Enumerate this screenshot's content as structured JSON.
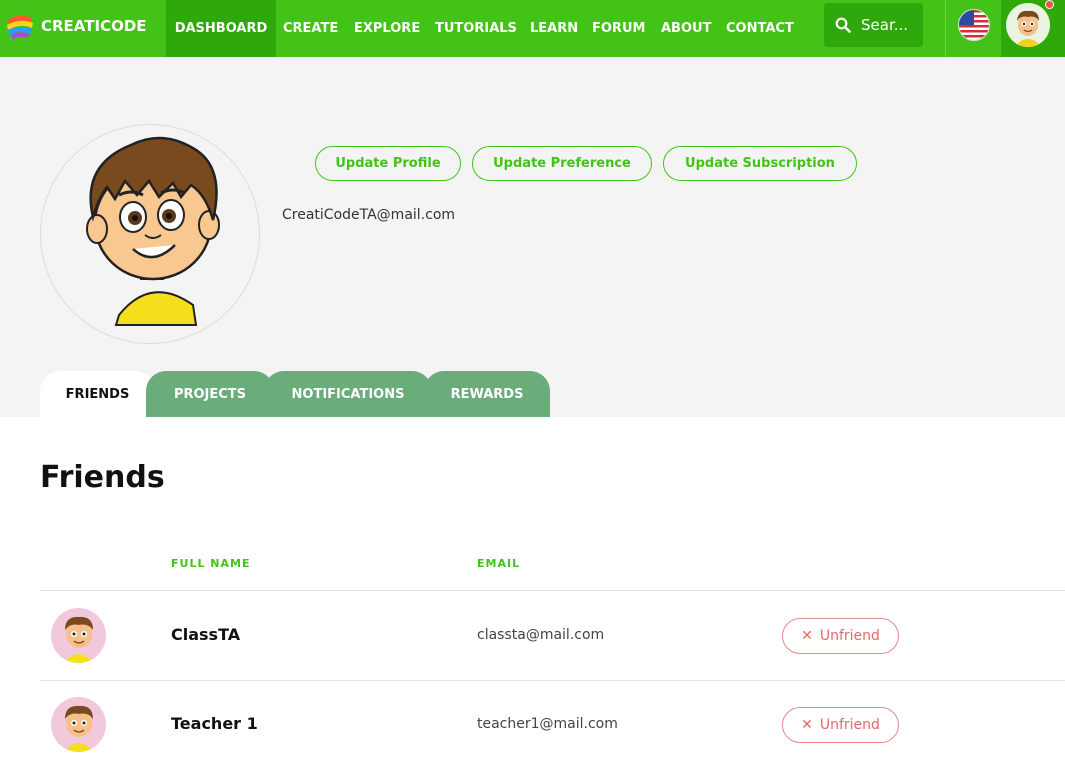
{
  "brand": {
    "name": "CREATICODE",
    "accent": "#43c318",
    "accent_dark": "#2ea80b"
  },
  "nav": {
    "items": [
      {
        "label": "DASHBOARD",
        "active": true
      },
      {
        "label": "CREATE"
      },
      {
        "label": "EXPLORE"
      },
      {
        "label": "TUTORIALS"
      },
      {
        "label": "LEARN"
      },
      {
        "label": "FORUM"
      },
      {
        "label": "ABOUT"
      },
      {
        "label": "CONTACT"
      }
    ],
    "search_placeholder": "Sear...",
    "language_icon": "us-flag-icon",
    "has_notification": true
  },
  "profile": {
    "buttons": {
      "update_profile": "Update Profile",
      "update_preference": "Update Preference",
      "update_subscription": "Update Subscription"
    },
    "email": "CreatiCodeTA@mail.com"
  },
  "tabs": [
    {
      "label": "FRIENDS",
      "active": true
    },
    {
      "label": "PROJECTS"
    },
    {
      "label": "NOTIFICATIONS"
    },
    {
      "label": "REWARDS"
    }
  ],
  "friends": {
    "title": "Friends",
    "columns": {
      "full_name": "FULL NAME",
      "email": "EMAIL"
    },
    "rows": [
      {
        "name": "ClassTA",
        "email": "classta@mail.com",
        "action": "Unfriend"
      },
      {
        "name": "Teacher 1",
        "email": "teacher1@mail.com",
        "action": "Unfriend"
      }
    ],
    "unfriend_color": "#e16a6a"
  }
}
